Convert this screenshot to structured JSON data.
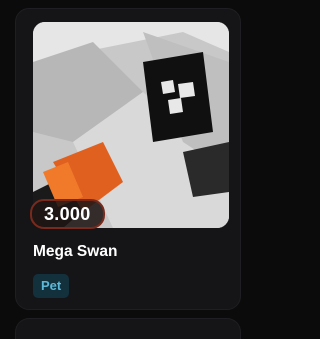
{
  "item": {
    "price": "3.000",
    "name": "Mega Swan",
    "tag": "Pet",
    "image_icon": "mega-swan-image-icon"
  },
  "colors": {
    "card_bg": "#151518",
    "tag_bg": "#13303d",
    "tag_text": "#5cb8d6",
    "price_border": "#7a2a1c"
  }
}
